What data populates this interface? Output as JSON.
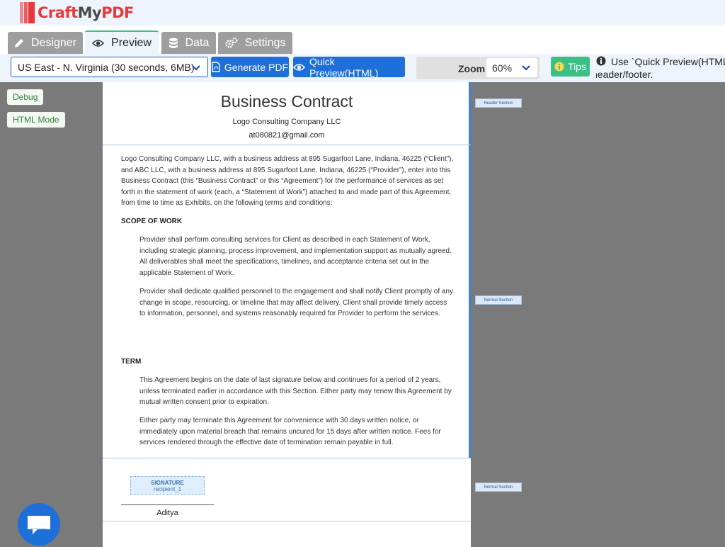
{
  "brand": {
    "name_red": "Craft",
    "name_dark": "My",
    "name_red2": "PDF"
  },
  "tabs": [
    {
      "label": "Designer",
      "icon": "pencil-icon",
      "active": false
    },
    {
      "label": "Preview",
      "icon": "eye-icon",
      "active": true
    },
    {
      "label": "Data",
      "icon": "database-icon",
      "active": false
    },
    {
      "label": "Settings",
      "icon": "gears-icon",
      "active": false
    }
  ],
  "toolbar": {
    "region": "US East - N. Virginia (30 seconds, 6MB)",
    "generate_pdf": "Generate PDF",
    "quick_preview": "Quick Preview(HTML)",
    "zoom_label": "Zoom",
    "zoom_value": "60%",
    "tips": "Tips",
    "hint_line1": "Use `Quick Preview(HTML)`",
    "hint_line2": "header/footer."
  },
  "side": {
    "debug": "Debug",
    "html_mode": "HTML Mode"
  },
  "document": {
    "title": "Business Contract",
    "company": "Logo Consulting Company LLC",
    "email": "at080821@gmail.com",
    "intro": "Logo Consulting Company LLC, with a business address at 895 Sugarfoot Lane, Indiana, 46225 (“Client”), and ABC LLC, with a business address at 895 Sugarfoot Lane, Indiana, 46225 (“Provider”), enter into this Business Contract (this “Business Contract” or this “Agreement”) for the performance of services as set forth in the statement of work (each, a “Statement of Work”) attached to and made part of this Agreement, from time to time as Exhibits, on the following terms and conditions:",
    "scope_heading": "SCOPE OF WORK",
    "scope_p1": "Provider shall perform consulting services for Client as described in each Statement of Work, including strategic planning, process improvement, and implementation support as mutually agreed. All deliverables shall meet the specifications, timelines, and acceptance criteria set out in the applicable Statement of Work.",
    "scope_p2": "Provider shall dedicate qualified personnel to the engagement and shall notify Client promptly of any change in scope, resourcing, or timeline that may affect delivery. Client shall provide timely access to information, personnel, and systems reasonably required for Provider to perform the services.",
    "term_heading": "TERM",
    "term_p1": "This Agreement begins on the date of last signature below and continues for a period of 2 years, unless terminated earlier in accordance with this Section. Either party may renew this Agreement by mutual written consent prior to expiration.",
    "term_p2": "Either party may terminate this Agreement for convenience with 30 days written notice, or immediately upon material breach that remains uncured for 15 days after written notice. Fees for services rendered through the effective date of termination remain payable in full.",
    "signature_label": "SIGNATURE",
    "signature_recipient": "recipient_1",
    "signer_name": "Aditya"
  },
  "section_labels": {
    "header": "Header Section",
    "normal1": "Normal Section",
    "normal2": "Normal Section"
  },
  "colors": {
    "accent_blue": "#1e6fd9",
    "accent_green": "#3cbf85",
    "brand_red": "#e8383d"
  }
}
